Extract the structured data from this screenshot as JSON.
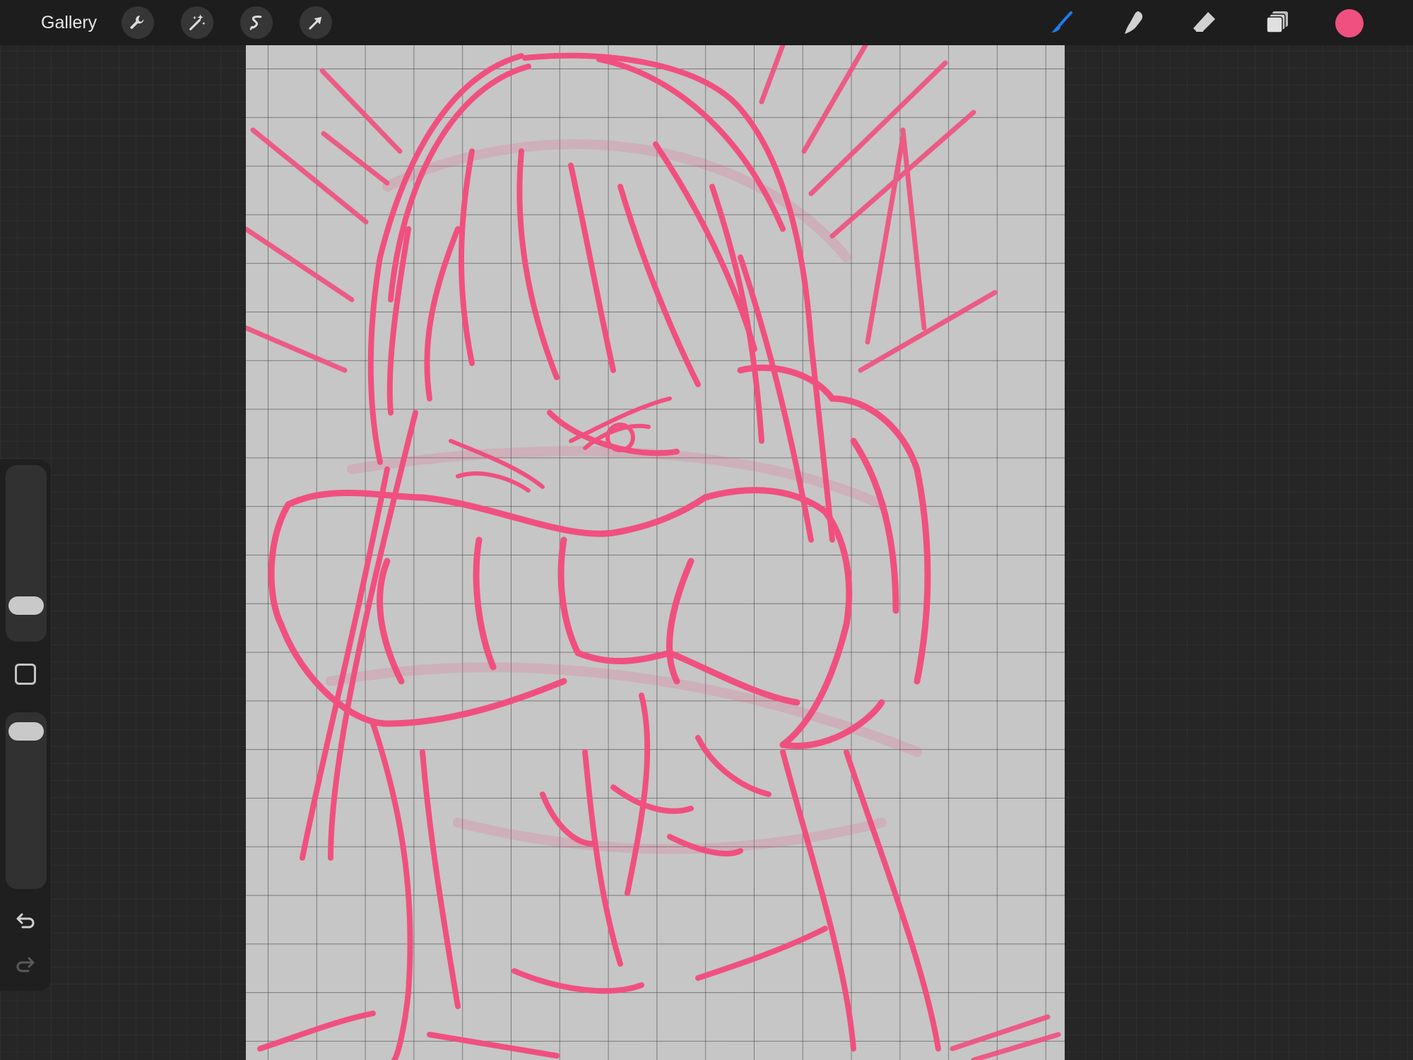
{
  "toolbar": {
    "gallery_label": "Gallery",
    "left_tools": [
      {
        "name": "actions",
        "icon": "wrench-icon"
      },
      {
        "name": "adjustments",
        "icon": "magic-wand-icon"
      },
      {
        "name": "selection",
        "icon": "selection-s-icon"
      },
      {
        "name": "transform",
        "icon": "arrow-cursor-icon"
      }
    ],
    "right_tools": [
      {
        "name": "brush",
        "icon": "brush-icon",
        "active": true,
        "color": "#1e7cf2"
      },
      {
        "name": "smudge",
        "icon": "smudge-finger-icon",
        "active": false
      },
      {
        "name": "eraser",
        "icon": "eraser-icon",
        "active": false
      },
      {
        "name": "layers",
        "icon": "layers-icon",
        "active": false
      }
    ],
    "current_color": "#f0507f"
  },
  "canvas": {
    "background": "#c6c6c6",
    "grid": true,
    "stroke_color": "#f0507f"
  },
  "sidebar": {
    "brush_size": 0.14,
    "opacity": 0.95,
    "icons": [
      "modifier-square-icon",
      "undo-icon",
      "redo-icon"
    ]
  }
}
